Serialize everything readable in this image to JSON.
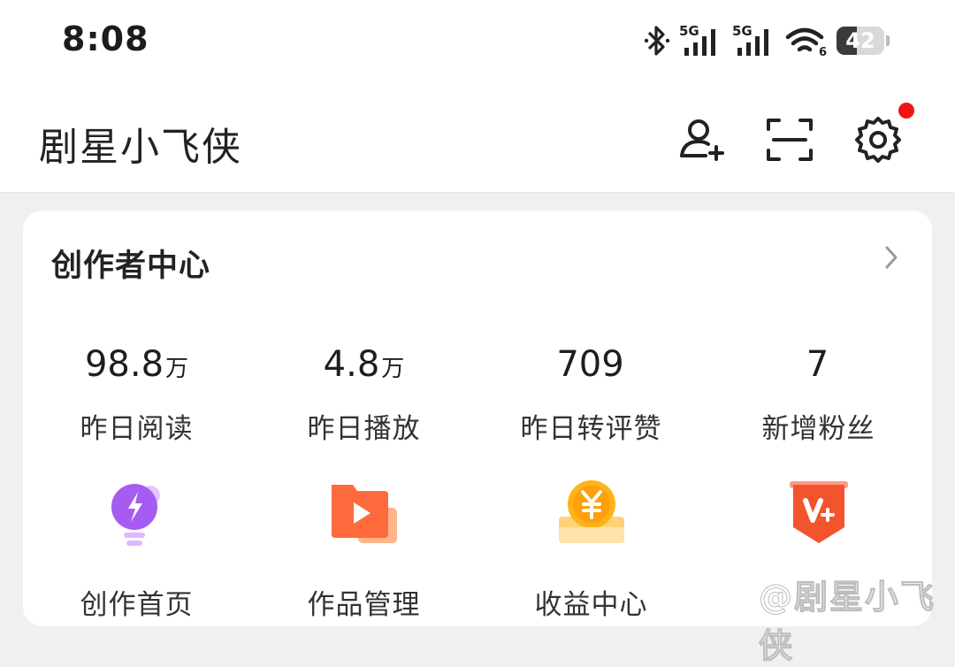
{
  "status_bar": {
    "time": "8:08",
    "battery": "42",
    "battery_level": 0.42,
    "network_1": "5G",
    "network_2": "5G",
    "wifi_badge": "6",
    "icons": [
      "bluetooth-icon",
      "signal-icon",
      "signal-icon",
      "wifi-icon",
      "battery-icon"
    ]
  },
  "header": {
    "title": "剧星小飞侠",
    "icons": [
      "add-friend-icon",
      "scan-icon",
      "settings-icon"
    ],
    "settings_has_notification": true
  },
  "creator_center": {
    "title": "创作者中心",
    "stats": [
      {
        "value": "98.8",
        "unit": "万",
        "label": "昨日阅读"
      },
      {
        "value": "4.8",
        "unit": "万",
        "label": "昨日播放"
      },
      {
        "value": "709",
        "unit": "",
        "label": "昨日转评赞"
      },
      {
        "value": "7",
        "unit": "",
        "label": "新增粉丝"
      }
    ],
    "tools": [
      {
        "label": "创作首页",
        "icon": "lightbulb-icon"
      },
      {
        "label": "作品管理",
        "icon": "video-folder-icon"
      },
      {
        "label": "收益中心",
        "icon": "yuan-coin-icon"
      },
      {
        "label": "",
        "icon": "v-plus-badge-icon"
      }
    ]
  },
  "watermark": "@剧星小飞侠",
  "colors": {
    "accent_red": "#f01414",
    "purple": "#a65cf0",
    "orange": "#ff6a3d",
    "gold": "#ffb21a"
  }
}
